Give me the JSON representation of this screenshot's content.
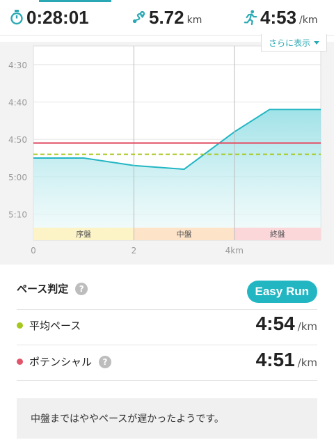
{
  "header": {
    "time": "0:28:01",
    "distance": "5.72",
    "distance_unit": "km",
    "pace": "4:53",
    "pace_unit": "/km",
    "more_label": "さらに表示"
  },
  "chart_data": {
    "type": "area",
    "y_ticks": [
      "4:30",
      "4:40",
      "4:50",
      "5:00",
      "5:10"
    ],
    "x_ticks": [
      "0",
      "2",
      "4km"
    ],
    "segments": [
      "序盤",
      "中盤",
      "終盤"
    ],
    "segment_colors": [
      "#fcf3c7",
      "#fde3c8",
      "#fbd7da"
    ],
    "x_unit": "km",
    "ylim_seconds_per_km": [
      265,
      317
    ],
    "xlim_km": [
      0,
      5.72
    ],
    "series": [
      {
        "values_km": [
          0,
          1.0,
          2.0,
          3.0,
          4.0,
          4.7,
          5.72
        ],
        "values_pace_seconds": [
          295,
          295,
          297,
          298,
          288,
          282,
          282
        ],
        "color": "#22b6c3"
      }
    ],
    "average_pace_seconds": 294,
    "potential_pace_seconds": 291,
    "average_color": "#a6c81e",
    "potential_color": "#e2546a"
  },
  "assessment": {
    "title": "ペース判定",
    "badge": "Easy Run",
    "rows": [
      {
        "label": "平均ペース",
        "value": "4:54",
        "unit": "/km",
        "dot_color": "#a6c81e"
      },
      {
        "label": "ポテンシャル",
        "value": "4:51",
        "unit": "/km",
        "dot_color": "#e2546a"
      }
    ],
    "comment": "中盤まではややペースが遅かったようです。"
  }
}
